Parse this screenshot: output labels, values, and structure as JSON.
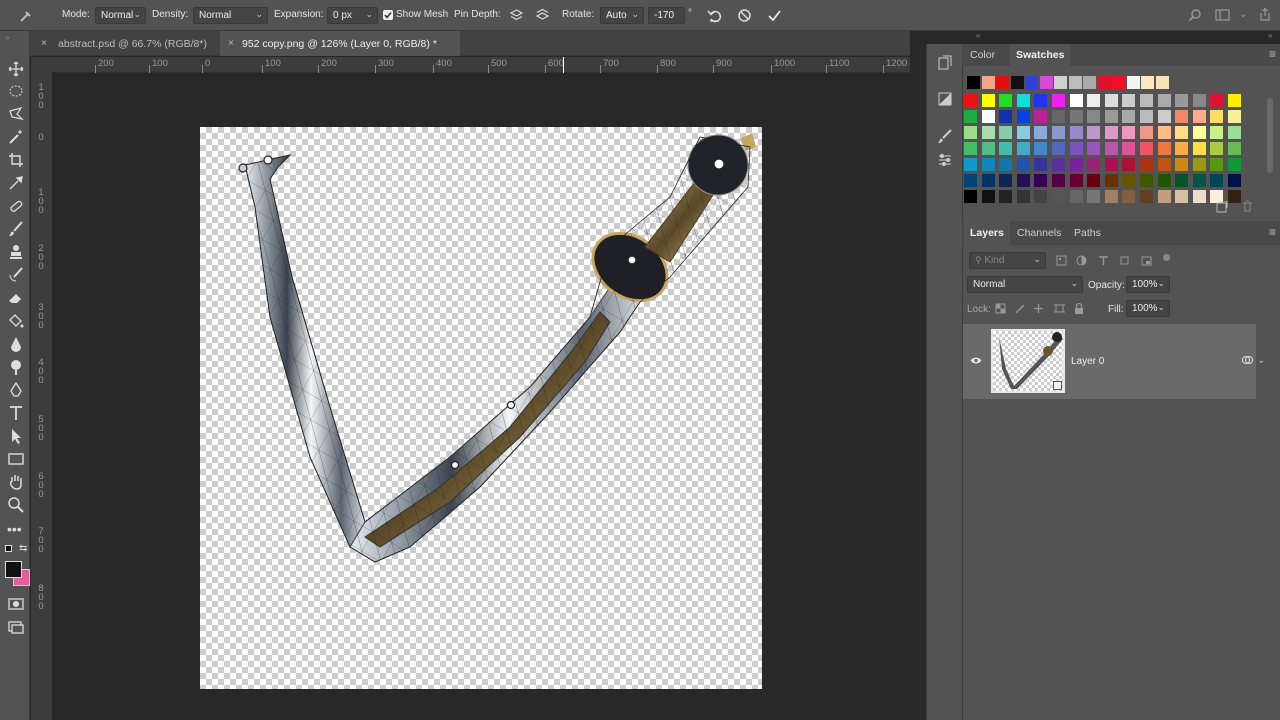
{
  "options_bar": {
    "mode_label": "Mode:",
    "mode_value": "Normal",
    "density_label": "Density:",
    "density_value": "Normal",
    "expansion_label": "Expansion:",
    "expansion_value": "0 px",
    "show_mesh_label": "Show Mesh",
    "show_mesh_checked": true,
    "pin_depth_label": "Pin Depth:",
    "rotate_label": "Rotate:",
    "rotate_value": "Auto",
    "rotate_angle": "-170",
    "degree_symbol": "°"
  },
  "tabs": [
    {
      "label": "abstract.psd @ 66.7% (RGB/8*)",
      "close": "×"
    },
    {
      "label": "952 copy.png @ 126% (Layer 0, RGB/8) *",
      "close": "×"
    }
  ],
  "ruler": {
    "horizontal": [
      "200",
      "100",
      "0",
      "100",
      "200",
      "300",
      "400",
      "500",
      "600",
      "700",
      "800",
      "900",
      "1000",
      "1100",
      "1200"
    ],
    "vertical": [
      "100",
      "0",
      "100",
      "200",
      "300",
      "400",
      "500",
      "600",
      "700",
      "800"
    ]
  },
  "swatch_panel": {
    "tabs": [
      "Color",
      "Swatches"
    ],
    "active_tab": "Swatches"
  },
  "swatches": {
    "row0": [
      "#000000",
      "#f2a48c",
      "#e01010",
      "#111111",
      "#3040d8",
      "#d84ad8",
      "#cfcfcf",
      "#bdbdbd",
      "#aaaaaa",
      "#e0102a",
      "#f0102a",
      "#f4f4f4",
      "#fbe8c0",
      "#f8e0b8"
    ],
    "rows": [
      [
        "#ee1111",
        "#ffff00",
        "#22dd22",
        "#11dddd",
        "#2233ee",
        "#ee22ee",
        "#ffffff",
        "#eeeeee",
        "#dddddd",
        "#cccccc",
        "#bbbbbb",
        "#aaaaaa",
        "#999999",
        "#888888",
        "#dd1133",
        "#ffee00"
      ],
      [
        "#22aa44",
        "#ffffff",
        "#1133aa",
        "#0044dd",
        "#bb2299",
        "#666666",
        "#777777",
        "#888888",
        "#999999",
        "#aaaaaa",
        "#bbbbbb",
        "#cccccc",
        "#ee8866",
        "#ffaa88",
        "#ffdd66",
        "#ffee99"
      ],
      [
        "#99dd88",
        "#aaddaa",
        "#88ccaa",
        "#88ccdd",
        "#88aadd",
        "#8899cc",
        "#9988cc",
        "#bb99cc",
        "#dd99cc",
        "#ee99bb",
        "#ee9988",
        "#ffbb88",
        "#ffdd88",
        "#ffff99",
        "#ccee88",
        "#99dd99"
      ],
      [
        "#44bb66",
        "#55bb88",
        "#44bbaa",
        "#44aacc",
        "#4488cc",
        "#5566bb",
        "#7755bb",
        "#9955bb",
        "#bb55aa",
        "#dd5599",
        "#ee5566",
        "#ee7744",
        "#ffaa44",
        "#ffdd44",
        "#aacc44",
        "#66bb55"
      ],
      [
        "#1199cc",
        "#1188bb",
        "#1177aa",
        "#2255aa",
        "#333399",
        "#553399",
        "#772299",
        "#992277",
        "#aa1155",
        "#aa1133",
        "#aa3311",
        "#bb5511",
        "#cc8811",
        "#999911",
        "#559911",
        "#119933"
      ],
      [
        "#004477",
        "#003366",
        "#112255",
        "#221155",
        "#330055",
        "#550044",
        "#660033",
        "#660011",
        "#663300",
        "#665500",
        "#445500",
        "#225500",
        "#005522",
        "#005544",
        "#004455",
        "#001144"
      ],
      [
        "#000000",
        "#111111",
        "#222222",
        "#333333",
        "#444444",
        "#555555",
        "#666666",
        "#777777",
        "#a08060",
        "#806040",
        "#604020",
        "#c0a080",
        "#d8c0a0",
        "#eeddcc",
        "#ffeedd",
        "#332211"
      ]
    ]
  },
  "layers_panel": {
    "tabs": [
      "Layers",
      "Channels",
      "Paths"
    ],
    "active_tab": "Layers",
    "kind_placeholder": "Kind",
    "blend_mode": "Normal",
    "opacity_label": "Opacity:",
    "opacity_value": "100%",
    "lock_label": "Lock:",
    "fill_label": "Fill:",
    "fill_value": "100%",
    "layers": [
      {
        "name": "Layer 0",
        "visible": true
      }
    ]
  },
  "colors": {
    "foreground": "#111111",
    "background": "#e060a0",
    "accent_ruler_marker": "#ffffff"
  }
}
